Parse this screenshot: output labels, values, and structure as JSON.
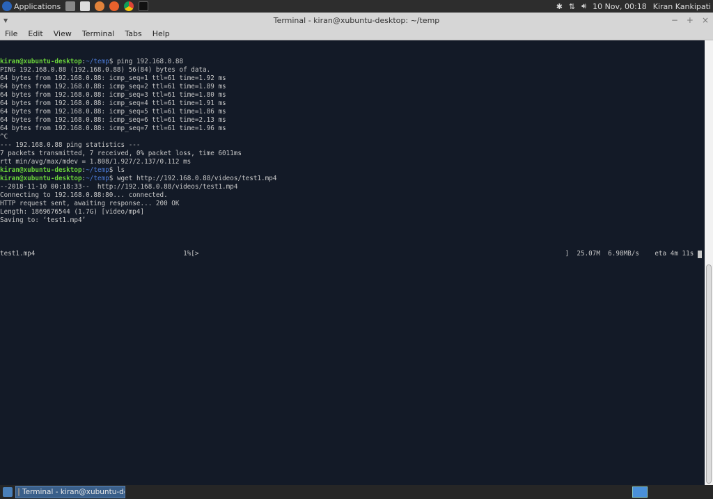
{
  "panel": {
    "applications": "Applications",
    "launchers": [
      "calculator-icon",
      "text-editor-icon",
      "mail-icon",
      "firefox-icon",
      "chrome-icon",
      "terminal-icon"
    ],
    "tray": [
      "bluetooth-icon",
      "network-icon",
      "volume-icon"
    ],
    "clock": "10 Nov, 00:18",
    "user": "Kiran Kankipati"
  },
  "window": {
    "title": "Terminal - kiran@xubuntu-desktop: ~/temp",
    "controls": {
      "minimize": "−",
      "maximize": "+",
      "close": "×"
    }
  },
  "menu": [
    "File",
    "Edit",
    "View",
    "Terminal",
    "Tabs",
    "Help"
  ],
  "terminal": {
    "prompt_user": "kiran@xubuntu-desktop",
    "prompt_path": "~/temp",
    "lines": [
      {
        "type": "prompt",
        "cmd": "ping 192.168.0.88"
      },
      {
        "type": "out",
        "text": "PING 192.168.0.88 (192.168.0.88) 56(84) bytes of data."
      },
      {
        "type": "out",
        "text": "64 bytes from 192.168.0.88: icmp_seq=1 ttl=61 time=1.92 ms"
      },
      {
        "type": "out",
        "text": "64 bytes from 192.168.0.88: icmp_seq=2 ttl=61 time=1.89 ms"
      },
      {
        "type": "out",
        "text": "64 bytes from 192.168.0.88: icmp_seq=3 ttl=61 time=1.80 ms"
      },
      {
        "type": "out",
        "text": "64 bytes from 192.168.0.88: icmp_seq=4 ttl=61 time=1.91 ms"
      },
      {
        "type": "out",
        "text": "64 bytes from 192.168.0.88: icmp_seq=5 ttl=61 time=1.86 ms"
      },
      {
        "type": "out",
        "text": "64 bytes from 192.168.0.88: icmp_seq=6 ttl=61 time=2.13 ms"
      },
      {
        "type": "out",
        "text": "64 bytes from 192.168.0.88: icmp_seq=7 ttl=61 time=1.96 ms"
      },
      {
        "type": "out",
        "text": "^C"
      },
      {
        "type": "out",
        "text": "--- 192.168.0.88 ping statistics ---"
      },
      {
        "type": "out",
        "text": "7 packets transmitted, 7 received, 0% packet loss, time 6011ms"
      },
      {
        "type": "out",
        "text": "rtt min/avg/max/mdev = 1.808/1.927/2.137/0.112 ms"
      },
      {
        "type": "prompt",
        "cmd": "ls"
      },
      {
        "type": "prompt",
        "cmd": "wget http://192.168.0.88/videos/test1.mp4"
      },
      {
        "type": "out",
        "text": "--2018-11-10 00:18:33--  http://192.168.0.88/videos/test1.mp4"
      },
      {
        "type": "out",
        "text": "Connecting to 192.168.0.88:80... connected."
      },
      {
        "type": "out",
        "text": "HTTP request sent, awaiting response... 200 OK"
      },
      {
        "type": "out",
        "text": "Length: 1869676544 (1.7G) [video/mp4]"
      },
      {
        "type": "out",
        "text": "Saving to: ‘test1.mp4’"
      },
      {
        "type": "out",
        "text": ""
      }
    ],
    "progress": {
      "file": "test1.mp4",
      "percent_label": "1%[>",
      "percent": 1,
      "end": "]",
      "downloaded": "25.07M",
      "speed": "6.98MB/s",
      "eta": "eta 4m 11s"
    }
  },
  "scrollbar": {
    "position_fraction": 0.5
  },
  "taskbar": {
    "task": "Terminal - kiran@xubuntu-de..."
  }
}
